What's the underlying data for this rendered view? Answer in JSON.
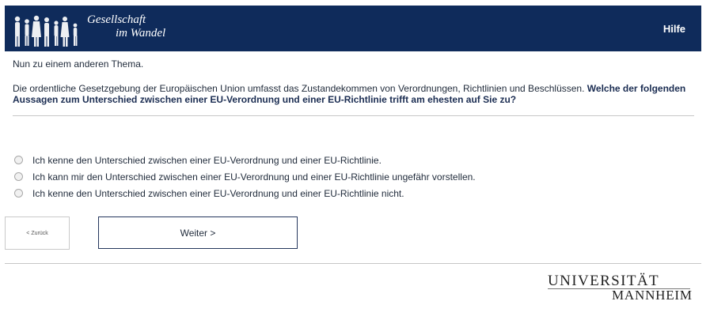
{
  "header": {
    "logo_line1": "Gesellschaft",
    "logo_line2": "im Wandel",
    "help_label": "Hilfe"
  },
  "survey": {
    "intro": "Nun zu einem anderen Thema.",
    "question_context": "Die ordentliche Gesetzgebung der Europäischen Union umfasst das Zustandekommen von Verordnungen, Richtlinien und Beschlüssen.",
    "question_bold": "Welche der folgenden Aussagen zum Unterschied zwischen einer EU-Verordnung und einer EU-Richtlinie trifft am ehesten auf Sie zu?",
    "options": [
      "Ich kenne den Unterschied zwischen einer EU-Verordnung und einer EU-Richtlinie.",
      "Ich kann mir den Unterschied zwischen einer EU-Verordnung und einer EU-Richtlinie ungefähr vorstellen.",
      "Ich kenne den Unterschied zwischen einer EU-Verordnung und einer EU-Richtlinie nicht."
    ]
  },
  "nav": {
    "back_label": "< Zurück",
    "next_label": "Weiter >"
  },
  "footer": {
    "uni_line1": "UNIVERSITÄT",
    "uni_line2": "MANNHEIM"
  },
  "colors": {
    "header_bg": "#0f2b5b",
    "next_border": "#24365c"
  },
  "icons": {
    "logo": "people-silhouettes-icon",
    "option": "radio-unchecked-icon"
  }
}
